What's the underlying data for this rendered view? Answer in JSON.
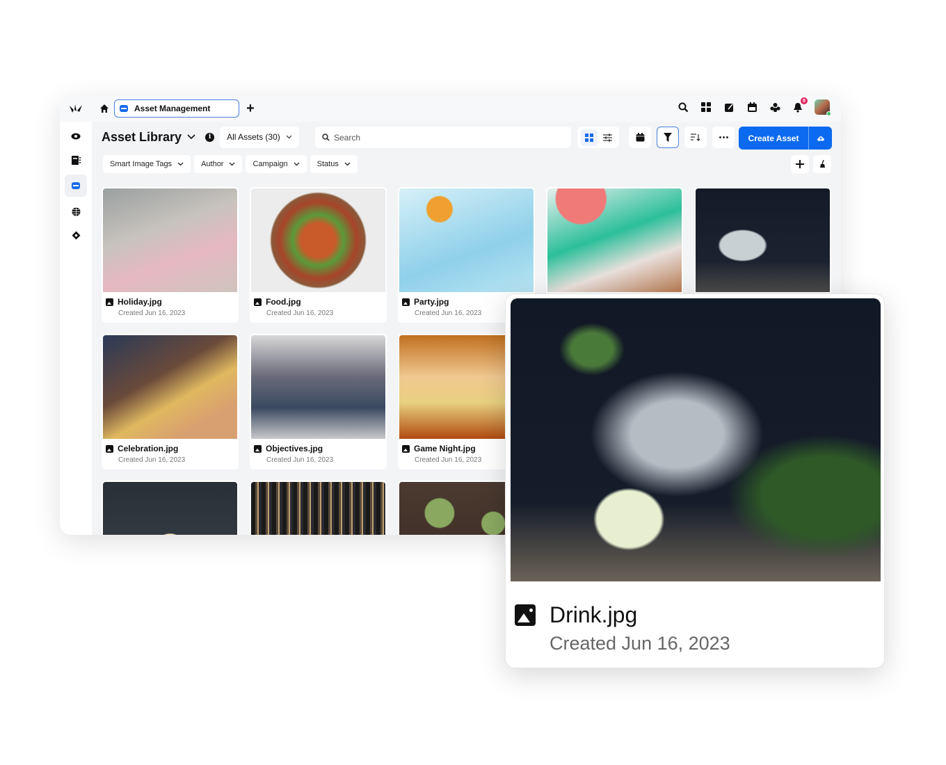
{
  "topbar": {
    "tab_label": "Asset Management",
    "notification_count": "8"
  },
  "header": {
    "title": "Asset Library",
    "view_select": "All Assets (30)",
    "search_placeholder": "Search",
    "create_button": "Create Asset"
  },
  "filters": [
    "Smart Image Tags",
    "Author",
    "Campaign",
    "Status"
  ],
  "assets": [
    {
      "name": "Holiday.jpg",
      "date": "Created Jun 16, 2023"
    },
    {
      "name": "Food.jpg",
      "date": "Created Jun 16, 2023"
    },
    {
      "name": "Party.jpg",
      "date": "Created Jun 16, 2023"
    },
    {
      "name": "",
      "date": ""
    },
    {
      "name": "",
      "date": ""
    },
    {
      "name": "Celebration.jpg",
      "date": "Created Jun 16, 2023"
    },
    {
      "name": "Objectives.jpg",
      "date": "Created Jun 16, 2023"
    },
    {
      "name": "Game Night.jpg",
      "date": "Created Jun 16, 2023"
    }
  ],
  "preview": {
    "name": "Drink.jpg",
    "date": "Created Jun 16, 2023"
  },
  "colors": {
    "accent": "#0b6af0",
    "badge": "#e0245e"
  }
}
